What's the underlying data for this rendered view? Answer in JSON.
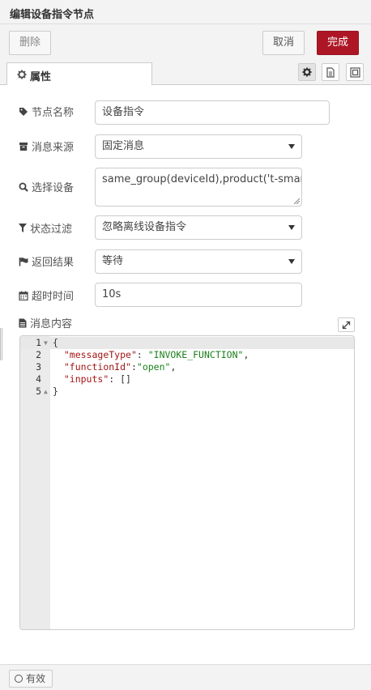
{
  "header": {
    "title": "编辑设备指令节点"
  },
  "toolbar": {
    "delete_label": "删除",
    "cancel_label": "取消",
    "done_label": "完成",
    "done_color": "#ad1625"
  },
  "tabs": {
    "properties_label": "属性"
  },
  "form": {
    "node_name": {
      "label": "节点名称",
      "value": "设备指令"
    },
    "message_source": {
      "label": "消息来源",
      "value": "固定消息"
    },
    "select_device": {
      "label": "选择设备",
      "value": "same_group(deviceId),product('t-smart-ac')"
    },
    "state_filter": {
      "label": "状态过滤",
      "value": "忽略离线设备指令"
    },
    "return_result": {
      "label": "返回结果",
      "value": "等待"
    },
    "timeout": {
      "label": "超时时间",
      "value": "10s"
    },
    "message_content": {
      "label": "消息内容"
    }
  },
  "editor": {
    "lines": [
      {
        "num": "1",
        "fold": true
      },
      {
        "num": "2"
      },
      {
        "num": "3"
      },
      {
        "num": "4"
      },
      {
        "num": "5",
        "fold": true
      }
    ],
    "code": {
      "open_brace": "{",
      "k1": "\"messageType\"",
      "v1": "\"INVOKE_FUNCTION\"",
      "k2": "\"functionId\"",
      "v2": "\"open\"",
      "k3": "\"inputs\"",
      "v3": "[]",
      "close_brace": "}"
    }
  },
  "footer": {
    "enabled_label": "有效"
  }
}
